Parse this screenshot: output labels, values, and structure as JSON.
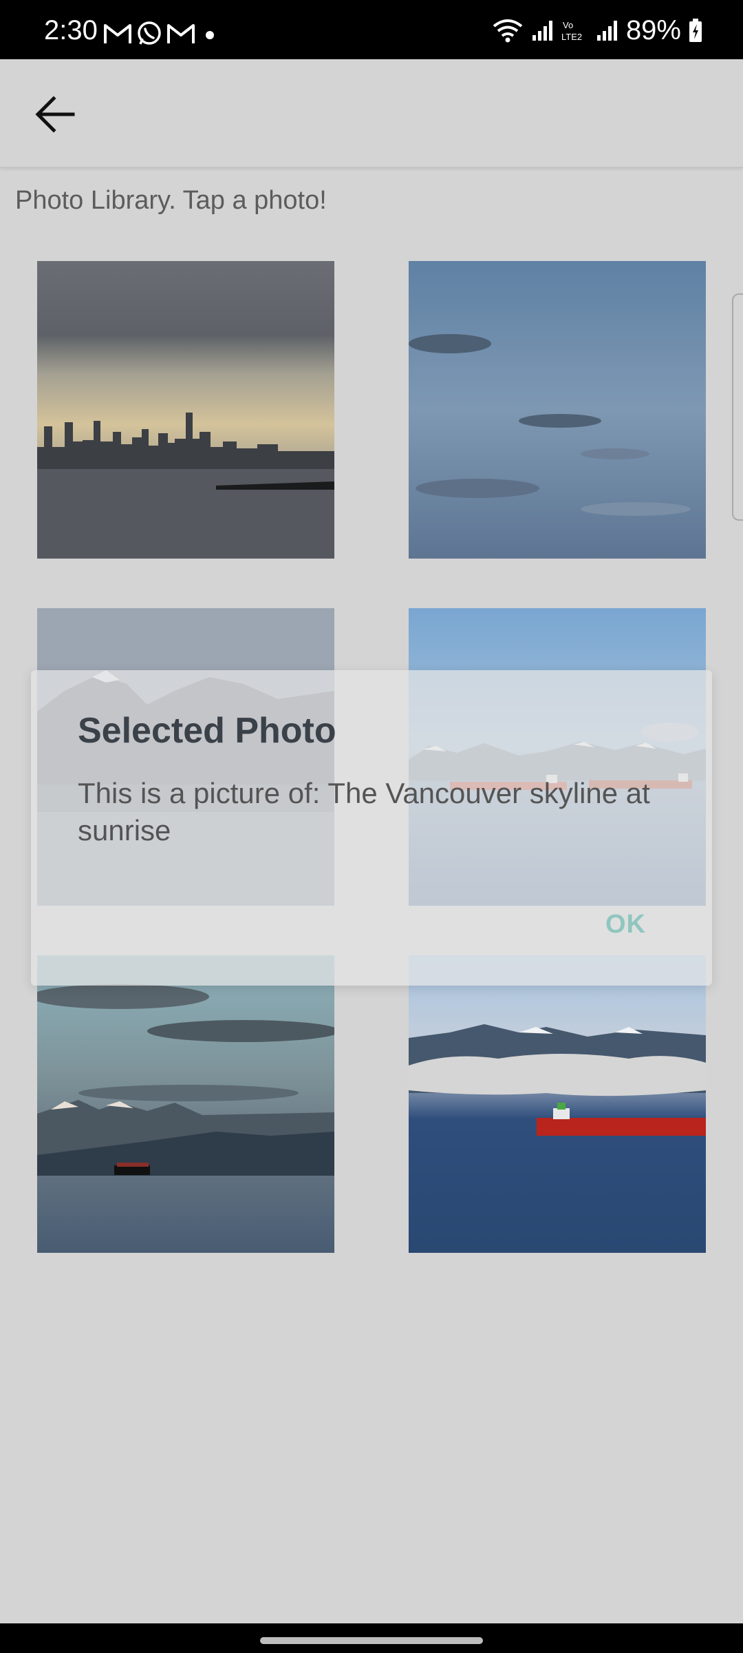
{
  "status_bar": {
    "time": "2:30",
    "battery": "89%",
    "notification_icons": [
      "gmail-icon",
      "whatsapp-icon",
      "gmail-icon",
      "dot-icon"
    ],
    "system_icons": [
      "wifi-icon",
      "signal-icon",
      "volte-icon",
      "signal-icon",
      "battery-icon"
    ],
    "volte_label": "Vo LTE2"
  },
  "app_bar": {
    "back_icon": "arrow-left-icon"
  },
  "library": {
    "header": "Photo Library. Tap a photo!",
    "photos": [
      {
        "name": "photo-skyline-sunrise"
      },
      {
        "name": "photo-sky-clouds"
      },
      {
        "name": "photo-mountains-haze"
      },
      {
        "name": "photo-ships-bay"
      },
      {
        "name": "photo-evening-ship"
      },
      {
        "name": "photo-red-ship-fog"
      }
    ]
  },
  "dialog": {
    "title": "Selected Photo",
    "message": "This is a picture of: The Vancouver skyline at sunrise",
    "ok_label": "OK"
  },
  "colors": {
    "background": "#d4d4d4",
    "dialog_title": "#3b4149",
    "ok_button": "#8fc6bf"
  }
}
